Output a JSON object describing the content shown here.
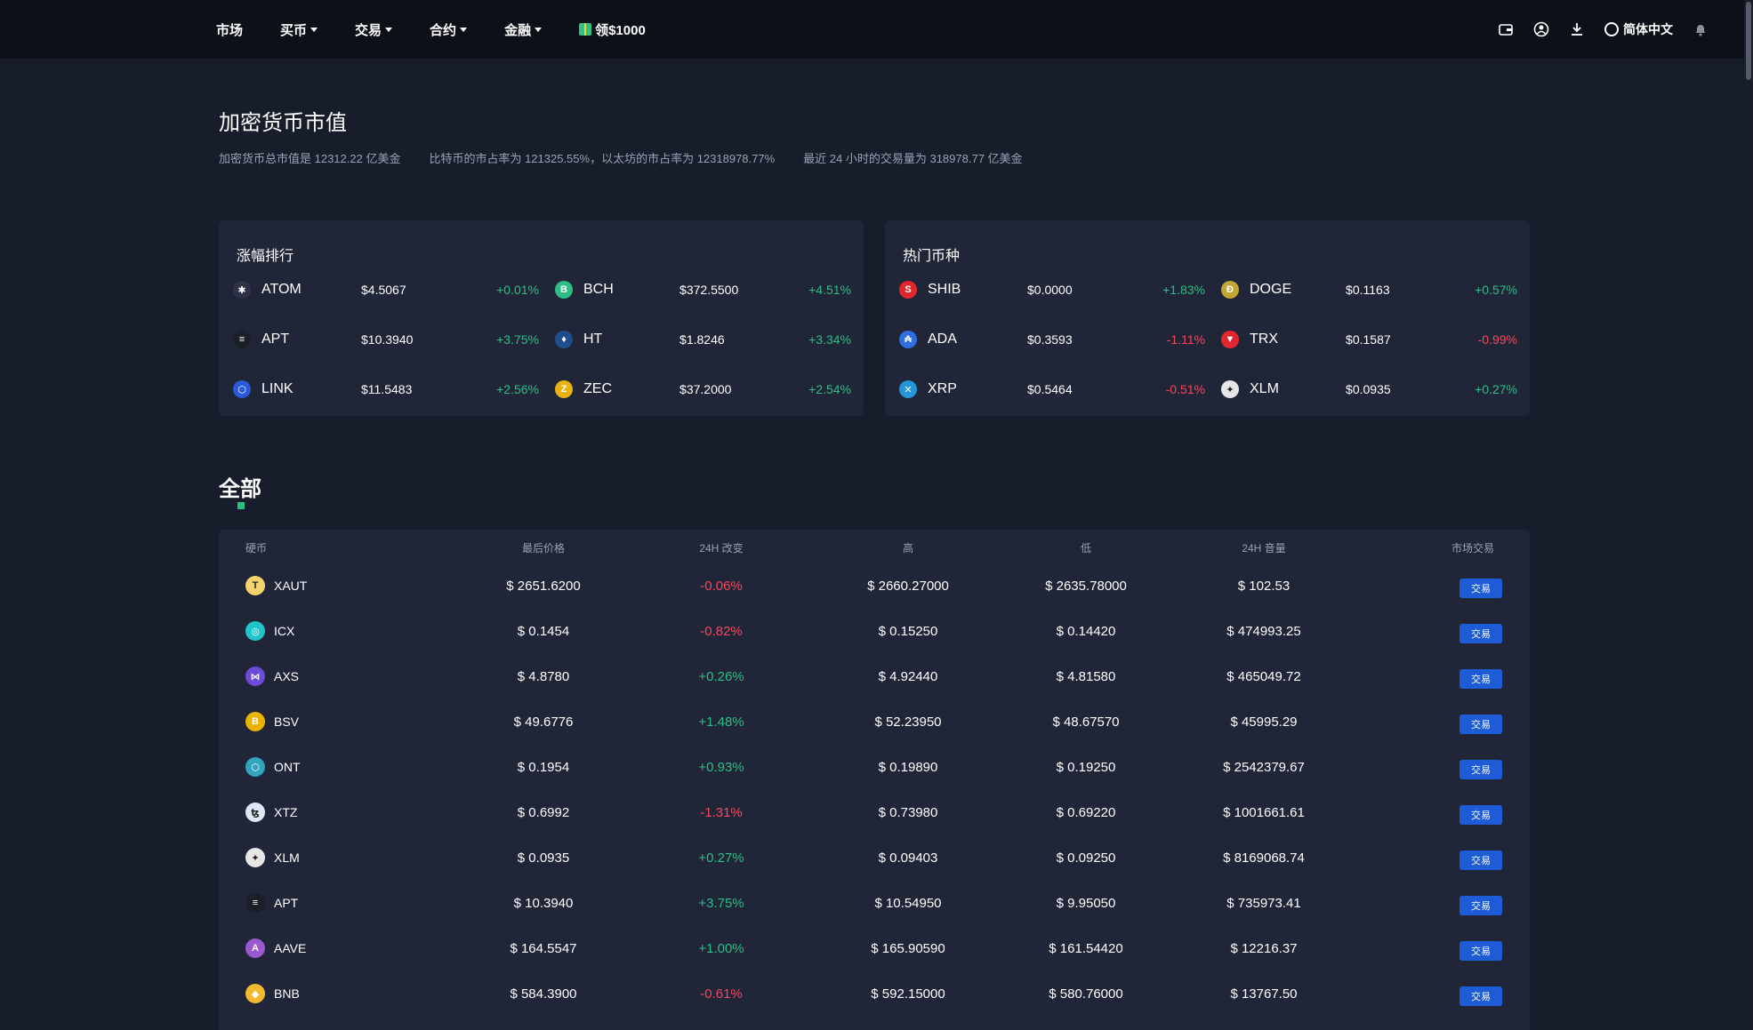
{
  "nav": {
    "items": [
      {
        "label": "市场",
        "caret": false
      },
      {
        "label": "买币",
        "caret": true
      },
      {
        "label": "交易",
        "caret": true
      },
      {
        "label": "合约",
        "caret": true
      },
      {
        "label": "金融",
        "caret": true
      }
    ],
    "promo": "领$1000",
    "lang": "简体中文",
    "icons": [
      "wallet-icon",
      "user-icon",
      "download-icon",
      "globe-icon",
      "bell-icon"
    ]
  },
  "hero": {
    "title": "加密货币市值",
    "stat1": "加密货币总市值是 12312.22 亿美金",
    "stat2": "比特币的市占率为 121325.55%，以太坊的市占率为 12318978.77%",
    "stat3": "最近 24 小时的交易量为 318978.77 亿美金"
  },
  "gainers": {
    "title": "涨幅排行",
    "rows": [
      [
        {
          "name": "ATOM",
          "price": "$4.5067",
          "change": "+0.01%",
          "dir": "up",
          "icon": "atom-icon",
          "color": "#2e3148",
          "glyph": "✱"
        },
        {
          "name": "BCH",
          "price": "$372.5500",
          "change": "+4.51%",
          "dir": "up",
          "icon": "bch-icon",
          "color": "#2ebd85",
          "glyph": "B"
        }
      ],
      [
        {
          "name": "APT",
          "price": "$10.3940",
          "change": "+3.75%",
          "dir": "up",
          "icon": "apt-icon",
          "color": "#1b1f2a",
          "glyph": "≡"
        },
        {
          "name": "HT",
          "price": "$1.8246",
          "change": "+3.34%",
          "dir": "up",
          "icon": "ht-icon",
          "color": "#1f4e8c",
          "glyph": "♦"
        }
      ],
      [
        {
          "name": "LINK",
          "price": "$11.5483",
          "change": "+2.56%",
          "dir": "up",
          "icon": "link-icon",
          "color": "#2a5ada",
          "glyph": "⬡"
        },
        {
          "name": "ZEC",
          "price": "$37.2000",
          "change": "+2.54%",
          "dir": "up",
          "icon": "zec-icon",
          "color": "#e8b30f",
          "glyph": "Z"
        }
      ]
    ]
  },
  "hot": {
    "title": "热门币种",
    "rows": [
      [
        {
          "name": "SHIB",
          "price": "$0.0000",
          "change": "+1.83%",
          "dir": "up",
          "icon": "shib-icon",
          "color": "#e3262e",
          "glyph": "S"
        },
        {
          "name": "DOGE",
          "price": "$0.1163",
          "change": "+0.57%",
          "dir": "up",
          "icon": "doge-icon",
          "color": "#c2a633",
          "glyph": "Ð"
        }
      ],
      [
        {
          "name": "ADA",
          "price": "$0.3593",
          "change": "-1.11%",
          "dir": "down",
          "icon": "ada-icon",
          "color": "#2f6de1",
          "glyph": "₳"
        },
        {
          "name": "TRX",
          "price": "$0.1587",
          "change": "-0.99%",
          "dir": "down",
          "icon": "trx-icon",
          "color": "#e3262e",
          "glyph": "▼"
        }
      ],
      [
        {
          "name": "XRP",
          "price": "$0.5464",
          "change": "-0.51%",
          "dir": "down",
          "icon": "xrp-icon",
          "color": "#2496d8",
          "glyph": "✕"
        },
        {
          "name": "XLM",
          "price": "$0.0935",
          "change": "+0.27%",
          "dir": "up",
          "icon": "xlm-icon",
          "color": "#e6e6e6",
          "glyph": "✦"
        }
      ]
    ]
  },
  "all": {
    "title": "全部",
    "headers": {
      "coin": "硬币",
      "price": "最后价格",
      "change": "24H 改变",
      "high": "高",
      "low": "低",
      "volume": "24H 音量",
      "trade": "市场交易"
    },
    "trade_label": "交易",
    "rows": [
      {
        "name": "XAUT",
        "price": "$ 2651.6200",
        "change": "-0.06%",
        "dir": "down",
        "high": "$ 2660.27000",
        "low": "$ 2635.78000",
        "volume": "$ 102.53",
        "color": "#f5d26b",
        "glyph": "T"
      },
      {
        "name": "ICX",
        "price": "$ 0.1454",
        "change": "-0.82%",
        "dir": "down",
        "high": "$ 0.15250",
        "low": "$ 0.14420",
        "volume": "$ 474993.25",
        "color": "#1fc5c9",
        "glyph": "◎"
      },
      {
        "name": "AXS",
        "price": "$ 4.8780",
        "change": "+0.26%",
        "dir": "up",
        "high": "$ 4.92440",
        "low": "$ 4.81580",
        "volume": "$ 465049.72",
        "color": "#6b4bd8",
        "glyph": "⋈"
      },
      {
        "name": "BSV",
        "price": "$ 49.6776",
        "change": "+1.48%",
        "dir": "up",
        "high": "$ 52.23950",
        "low": "$ 48.67570",
        "volume": "$ 45995.29",
        "color": "#eab300",
        "glyph": "B"
      },
      {
        "name": "ONT",
        "price": "$ 0.1954",
        "change": "+0.93%",
        "dir": "up",
        "high": "$ 0.19890",
        "low": "$ 0.19250",
        "volume": "$ 2542379.67",
        "color": "#32a4be",
        "glyph": "⬡"
      },
      {
        "name": "XTZ",
        "price": "$ 0.6992",
        "change": "-1.31%",
        "dir": "down",
        "high": "$ 0.73980",
        "low": "$ 0.69220",
        "volume": "$ 1001661.61",
        "color": "#dfe6f5",
        "glyph": "ꜩ"
      },
      {
        "name": "XLM",
        "price": "$ 0.0935",
        "change": "+0.27%",
        "dir": "up",
        "high": "$ 0.09403",
        "low": "$ 0.09250",
        "volume": "$ 8169068.74",
        "color": "#e6e6e6",
        "glyph": "✦"
      },
      {
        "name": "APT",
        "price": "$ 10.3940",
        "change": "+3.75%",
        "dir": "up",
        "high": "$ 10.54950",
        "low": "$ 9.95050",
        "volume": "$ 735973.41",
        "color": "#1b1f2a",
        "glyph": "≡"
      },
      {
        "name": "AAVE",
        "price": "$ 164.5547",
        "change": "+1.00%",
        "dir": "up",
        "high": "$ 165.90590",
        "low": "$ 161.54420",
        "volume": "$ 12216.37",
        "color": "#9b59d0",
        "glyph": "A"
      },
      {
        "name": "BNB",
        "price": "$ 584.3900",
        "change": "-0.61%",
        "dir": "down",
        "high": "$ 592.15000",
        "low": "$ 580.76000",
        "volume": "$ 13767.50",
        "color": "#f3ba2f",
        "glyph": "◆"
      }
    ]
  }
}
